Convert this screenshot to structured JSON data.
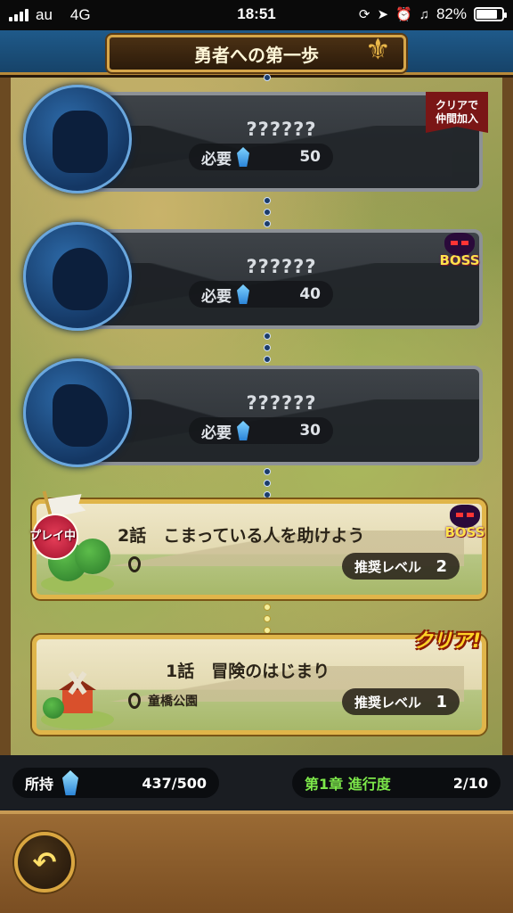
{
  "status_bar": {
    "carrier": "au",
    "network": "4G",
    "time": "18:51",
    "battery": "82%",
    "battery_level": 0.82
  },
  "header": {
    "title": "勇者への第一歩"
  },
  "locked_chapters": [
    {
      "title": "??????",
      "requirement_label": "必要",
      "requirement_value": "50",
      "badge": "クリアで仲間加入",
      "badge_line1": "クリアで",
      "badge_line2": "仲間加入"
    },
    {
      "title": "??????",
      "requirement_label": "必要",
      "requirement_value": "40",
      "badge": "BOSS"
    },
    {
      "title": "??????",
      "requirement_label": "必要",
      "requirement_value": "30"
    }
  ],
  "current_chapter": {
    "status_label": "プレイ中",
    "title": "2話　こまっている人を助けよう",
    "badge": "BOSS",
    "recommended_label": "推奨レベル",
    "recommended_level": "2"
  },
  "cleared_chapter": {
    "clear_label": "クリア!",
    "title": "1話　冒険のはじまり",
    "location": "童橋公園",
    "recommended_label": "推奨レベル",
    "recommended_level": "1"
  },
  "info_bar": {
    "owned_label": "所持",
    "owned_value": "437/500",
    "progress_label": "第1章 進行度",
    "progress_value": "2/10"
  },
  "footer": {
    "back_icon": "back-arrow-icon"
  },
  "colors": {
    "header_blue": "#1f5a8a",
    "gold": "#d6a64a",
    "progress_green": "#7de84a",
    "boss_yellow": "#ffe24a",
    "clear_yellow": "#ffd326"
  }
}
